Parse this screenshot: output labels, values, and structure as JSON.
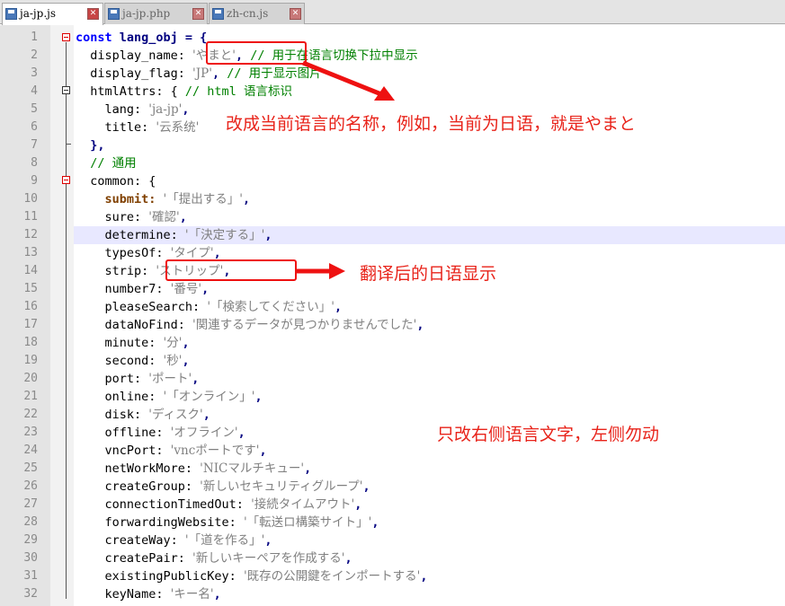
{
  "tabs": [
    {
      "label": "ja-jp.js",
      "active": true
    },
    {
      "label": "ja-jp.php",
      "active": false
    },
    {
      "label": "zh-cn.js",
      "active": false
    }
  ],
  "lines": [
    {
      "n": "1",
      "segs": [
        {
          "t": "const ",
          "c": "kw"
        },
        {
          "t": "lang_obj = {",
          "c": "pn"
        }
      ]
    },
    {
      "n": "2",
      "segs": [
        {
          "t": "  display_name: ",
          "c": "key"
        },
        {
          "t": "'やまと'",
          "c": "str"
        },
        {
          "t": ", ",
          "c": "pn"
        },
        {
          "t": "// 用于在语言切换下拉中显示",
          "c": "cm"
        }
      ]
    },
    {
      "n": "3",
      "segs": [
        {
          "t": "  display_flag: ",
          "c": "key"
        },
        {
          "t": "'JP'",
          "c": "str"
        },
        {
          "t": ", ",
          "c": "pn"
        },
        {
          "t": "// 用于显示图片",
          "c": "cm"
        }
      ]
    },
    {
      "n": "4",
      "segs": [
        {
          "t": "  htmlAttrs: { ",
          "c": "key"
        },
        {
          "t": "// html 语言标识",
          "c": "cm"
        }
      ]
    },
    {
      "n": "5",
      "segs": [
        {
          "t": "    lang: ",
          "c": "key"
        },
        {
          "t": "'ja-jp'",
          "c": "str"
        },
        {
          "t": ",",
          "c": "pn"
        }
      ]
    },
    {
      "n": "6",
      "segs": [
        {
          "t": "    title: ",
          "c": "key"
        },
        {
          "t": "'云系统'",
          "c": "str"
        }
      ]
    },
    {
      "n": "7",
      "segs": [
        {
          "t": "  },",
          "c": "pn"
        }
      ]
    },
    {
      "n": "8",
      "segs": [
        {
          "t": "  // 通用",
          "c": "cm"
        }
      ]
    },
    {
      "n": "9",
      "segs": [
        {
          "t": "  common: {",
          "c": "key"
        }
      ]
    },
    {
      "n": "10",
      "segs": [
        {
          "t": "    submit: ",
          "c": "keyb"
        },
        {
          "t": "'「提出する」'",
          "c": "str"
        },
        {
          "t": ",",
          "c": "pn"
        }
      ]
    },
    {
      "n": "11",
      "segs": [
        {
          "t": "    sure: ",
          "c": "key"
        },
        {
          "t": "'確認'",
          "c": "str"
        },
        {
          "t": ",",
          "c": "pn"
        }
      ]
    },
    {
      "n": "12",
      "segs": [
        {
          "t": "    determine: ",
          "c": "key"
        },
        {
          "t": "'「決定する」'",
          "c": "str"
        },
        {
          "t": ",",
          "c": "pn"
        }
      ]
    },
    {
      "n": "13",
      "segs": [
        {
          "t": "    typesOf: ",
          "c": "key"
        },
        {
          "t": "'タイプ'",
          "c": "str"
        },
        {
          "t": ",",
          "c": "pn"
        }
      ]
    },
    {
      "n": "14",
      "segs": [
        {
          "t": "    strip: ",
          "c": "key"
        },
        {
          "t": "'ストリップ'",
          "c": "str"
        },
        {
          "t": ",",
          "c": "pn"
        }
      ]
    },
    {
      "n": "15",
      "segs": [
        {
          "t": "    number7: ",
          "c": "key"
        },
        {
          "t": "'番号'",
          "c": "str"
        },
        {
          "t": ",",
          "c": "pn"
        }
      ]
    },
    {
      "n": "16",
      "segs": [
        {
          "t": "    pleaseSearch: ",
          "c": "key"
        },
        {
          "t": "'「検索してください」'",
          "c": "str"
        },
        {
          "t": ",",
          "c": "pn"
        }
      ]
    },
    {
      "n": "17",
      "segs": [
        {
          "t": "    dataNoFind: ",
          "c": "key"
        },
        {
          "t": "'関連するデータが見つかりませんでした'",
          "c": "str"
        },
        {
          "t": ",",
          "c": "pn"
        }
      ]
    },
    {
      "n": "18",
      "segs": [
        {
          "t": "    minute: ",
          "c": "key"
        },
        {
          "t": "'分'",
          "c": "str"
        },
        {
          "t": ",",
          "c": "pn"
        }
      ]
    },
    {
      "n": "19",
      "segs": [
        {
          "t": "    second: ",
          "c": "key"
        },
        {
          "t": "'秒'",
          "c": "str"
        },
        {
          "t": ",",
          "c": "pn"
        }
      ]
    },
    {
      "n": "20",
      "segs": [
        {
          "t": "    port: ",
          "c": "key"
        },
        {
          "t": "'ポート'",
          "c": "str"
        },
        {
          "t": ",",
          "c": "pn"
        }
      ]
    },
    {
      "n": "21",
      "segs": [
        {
          "t": "    online: ",
          "c": "key"
        },
        {
          "t": "'「オンライン」'",
          "c": "str"
        },
        {
          "t": ",",
          "c": "pn"
        }
      ]
    },
    {
      "n": "22",
      "segs": [
        {
          "t": "    disk: ",
          "c": "key"
        },
        {
          "t": "'ディスク'",
          "c": "str"
        },
        {
          "t": ",",
          "c": "pn"
        }
      ]
    },
    {
      "n": "23",
      "segs": [
        {
          "t": "    offline: ",
          "c": "key"
        },
        {
          "t": "'オフライン'",
          "c": "str"
        },
        {
          "t": ",",
          "c": "pn"
        }
      ]
    },
    {
      "n": "24",
      "segs": [
        {
          "t": "    vncPort: ",
          "c": "key"
        },
        {
          "t": "'vncポートです'",
          "c": "str"
        },
        {
          "t": ",",
          "c": "pn"
        }
      ]
    },
    {
      "n": "25",
      "segs": [
        {
          "t": "    netWorkMore: ",
          "c": "key"
        },
        {
          "t": "'NICマルチキュー'",
          "c": "str"
        },
        {
          "t": ",",
          "c": "pn"
        }
      ]
    },
    {
      "n": "26",
      "segs": [
        {
          "t": "    createGroup: ",
          "c": "key"
        },
        {
          "t": "'新しいセキュリティグループ'",
          "c": "str"
        },
        {
          "t": ",",
          "c": "pn"
        }
      ]
    },
    {
      "n": "27",
      "segs": [
        {
          "t": "    connectionTimedOut: ",
          "c": "key"
        },
        {
          "t": "'接続タイムアウト'",
          "c": "str"
        },
        {
          "t": ",",
          "c": "pn"
        }
      ]
    },
    {
      "n": "28",
      "segs": [
        {
          "t": "    forwardingWebsite: ",
          "c": "key"
        },
        {
          "t": "'「転送ロ構築サイト」'",
          "c": "str"
        },
        {
          "t": ",",
          "c": "pn"
        }
      ]
    },
    {
      "n": "29",
      "segs": [
        {
          "t": "    createWay: ",
          "c": "key"
        },
        {
          "t": "'「道を作る」'",
          "c": "str"
        },
        {
          "t": ",",
          "c": "pn"
        }
      ]
    },
    {
      "n": "30",
      "segs": [
        {
          "t": "    createPair: ",
          "c": "key"
        },
        {
          "t": "'新しいキーペアを作成する'",
          "c": "str"
        },
        {
          "t": ",",
          "c": "pn"
        }
      ]
    },
    {
      "n": "31",
      "segs": [
        {
          "t": "    existingPublicKey: ",
          "c": "key"
        },
        {
          "t": "'既存の公開鍵をインポートする'",
          "c": "str"
        },
        {
          "t": ",",
          "c": "pn"
        }
      ]
    },
    {
      "n": "32",
      "segs": [
        {
          "t": "    keyName: ",
          "c": "key"
        },
        {
          "t": "'キー名'",
          "c": "str"
        },
        {
          "t": ",",
          "c": "pn"
        }
      ]
    }
  ],
  "highlighted_line": "12",
  "annotations": {
    "a1": "改成当前语言的名称，例如，当前为日语，就是やまと",
    "a2": "翻译后的日语显示",
    "a3": "只改右侧语言文字，左侧勿动"
  },
  "colors": {
    "annotation": "#e8231a",
    "keyword": "#0000ff",
    "comment": "#008000",
    "string": "#808080"
  }
}
